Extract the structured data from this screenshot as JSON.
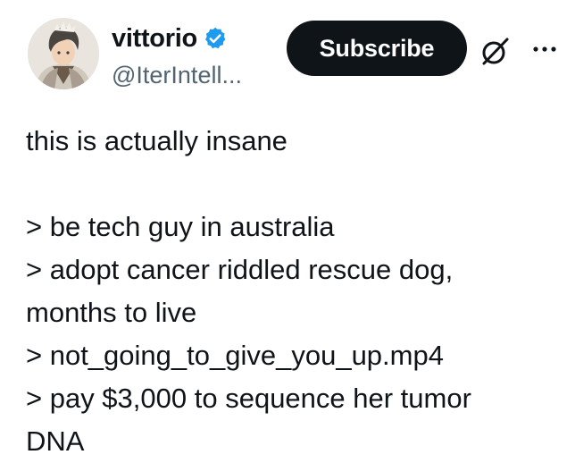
{
  "author": {
    "display_name": "vittorio",
    "handle": "@IterIntell...",
    "verified_color": "#1d9bf0"
  },
  "actions": {
    "subscribe_label": "Subscribe",
    "grok_icon": "grok-icon",
    "more_icon": "more-icon"
  },
  "tweet": {
    "lines": [
      "this is actually insane",
      "",
      "> be tech guy in australia",
      "> adopt cancer riddled rescue dog,",
      "months to live",
      "> not_going_to_give_you_up.mp4",
      "> pay $3,000 to sequence her tumor",
      "DNA"
    ]
  },
  "colors": {
    "text": "#0f1419",
    "secondary": "#536471",
    "button_bg": "#0f1419",
    "button_text": "#ffffff"
  }
}
